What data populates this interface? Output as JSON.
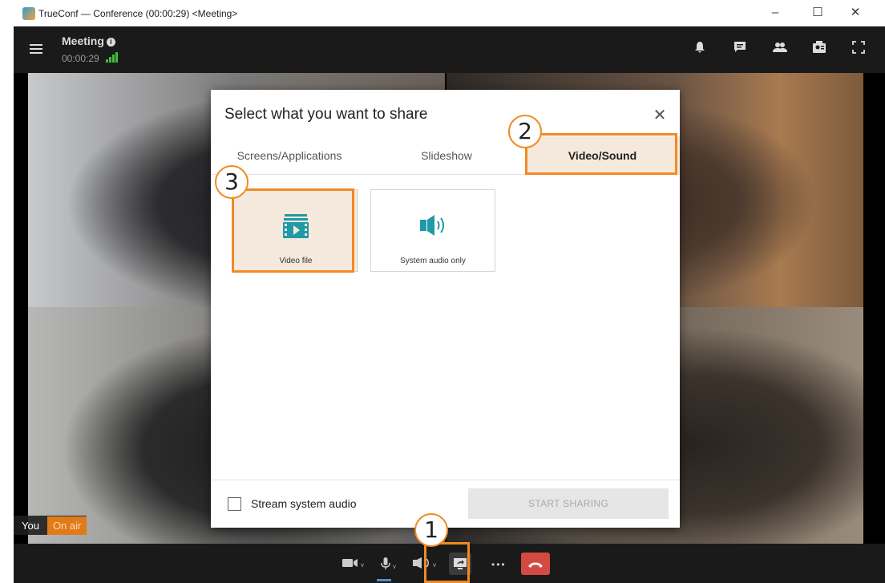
{
  "window": {
    "title": "TrueConf — Conference (00:00:29) <Meeting>",
    "minimize": "–",
    "maximize": "☐",
    "close": "✕"
  },
  "header": {
    "meeting_title": "Meeting",
    "info_glyph": "i",
    "elapsed": "00:00:29",
    "icons": [
      "bell-icon",
      "chat-icon",
      "participants-icon",
      "contacts-icon",
      "fullscreen-icon"
    ]
  },
  "video": {
    "you_label": "You",
    "on_air_label": "On air"
  },
  "dialog": {
    "title": "Select what you want to share",
    "close_glyph": "✕",
    "tabs": [
      {
        "label": "Screens/Applications",
        "active": false
      },
      {
        "label": "Slideshow",
        "active": false
      },
      {
        "label": "Video/Sound",
        "active": true
      }
    ],
    "options": [
      {
        "label": "Video file",
        "icon": "video-file-icon",
        "selected": true
      },
      {
        "label": "System audio only",
        "icon": "speaker-icon",
        "selected": false
      }
    ],
    "stream_audio_label": "Stream system audio",
    "stream_audio_checked": false,
    "start_button": "START SHARING"
  },
  "toolbar": {
    "buttons": [
      "camera-icon",
      "microphone-icon",
      "speaker-icon",
      "share-screen-icon",
      "more-icon",
      "hang-up-icon"
    ],
    "more_glyph": "•••"
  },
  "annotations": {
    "step1": "1",
    "step2": "2",
    "step3": "3"
  },
  "colors": {
    "accent": "#f08a24",
    "selected_bg": "#f5e8dc",
    "teal_icon": "#1f9aa6",
    "hangup": "#d24a42"
  }
}
